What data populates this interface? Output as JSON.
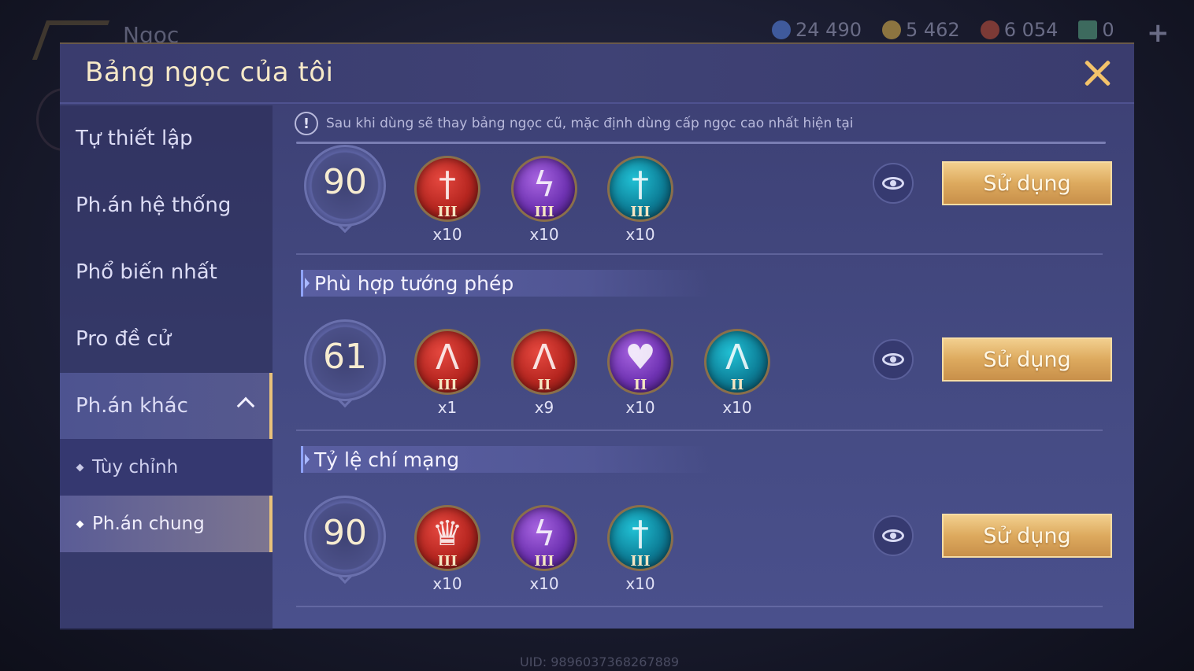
{
  "background": {
    "title": "Ngọc",
    "currencies": [
      {
        "icon": "gem-coin-icon",
        "value": "24 490",
        "color": "#3f6bc4"
      },
      {
        "icon": "gold-coin-icon",
        "value": "5 462",
        "color": "#d7a23c"
      },
      {
        "icon": "red-voucher-icon",
        "value": "6 054",
        "color": "#c23b2c"
      },
      {
        "icon": "card-icon",
        "value": "0",
        "color": "#3aa886"
      }
    ],
    "uid": "UID: 9896037368267889"
  },
  "dialog": {
    "title": "Bảng ngọc của tôi"
  },
  "sidebar": {
    "items": [
      {
        "label": "Tự thiết lập"
      },
      {
        "label": "Ph.án hệ thống"
      },
      {
        "label": "Phổ biến nhất"
      },
      {
        "label": "Pro đề cử"
      },
      {
        "label": "Ph.án khác"
      }
    ],
    "subitems": [
      {
        "label": "Tùy chỉnh"
      },
      {
        "label": "Ph.án chung"
      }
    ]
  },
  "notice": {
    "icon": "!",
    "text": "Sau khi dùng sẽ thay bảng ngọc cũ, mặc định dùng cấp ngọc cao nhất hiện tại"
  },
  "setups": [
    {
      "section": "",
      "level": "90",
      "gems": [
        {
          "color": "red",
          "icon": "sword-icon",
          "glyph": "†",
          "tier": "III",
          "count": "x10"
        },
        {
          "color": "purple",
          "icon": "lightning-icon",
          "glyph": "ϟ",
          "tier": "III",
          "count": "x10"
        },
        {
          "color": "teal",
          "icon": "sword-icon",
          "glyph": "†",
          "tier": "III",
          "count": "x10"
        }
      ],
      "button": "Sử dụng"
    },
    {
      "section": "Phù hợp tướng phép",
      "level": "61",
      "gems": [
        {
          "color": "red",
          "icon": "dagger-icon",
          "glyph": "Ʌ",
          "tier": "III",
          "count": "x1"
        },
        {
          "color": "red",
          "icon": "dagger-icon",
          "glyph": "Ʌ",
          "tier": "II",
          "count": "x9"
        },
        {
          "color": "purple",
          "icon": "heart-icon",
          "glyph": "♥",
          "tier": "II",
          "count": "x10"
        },
        {
          "color": "teal",
          "icon": "dagger-icon",
          "glyph": "Ʌ",
          "tier": "II",
          "count": "x10"
        }
      ],
      "button": "Sử dụng"
    },
    {
      "section": "Tỷ lệ chí mạng",
      "level": "90",
      "gems": [
        {
          "color": "red",
          "icon": "crown-icon",
          "glyph": "♛",
          "tier": "III",
          "count": "x10"
        },
        {
          "color": "purple",
          "icon": "lightning-icon",
          "glyph": "ϟ",
          "tier": "III",
          "count": "x10"
        },
        {
          "color": "teal",
          "icon": "sword-icon",
          "glyph": "†",
          "tier": "III",
          "count": "x10"
        }
      ],
      "button": "Sử dụng"
    }
  ]
}
